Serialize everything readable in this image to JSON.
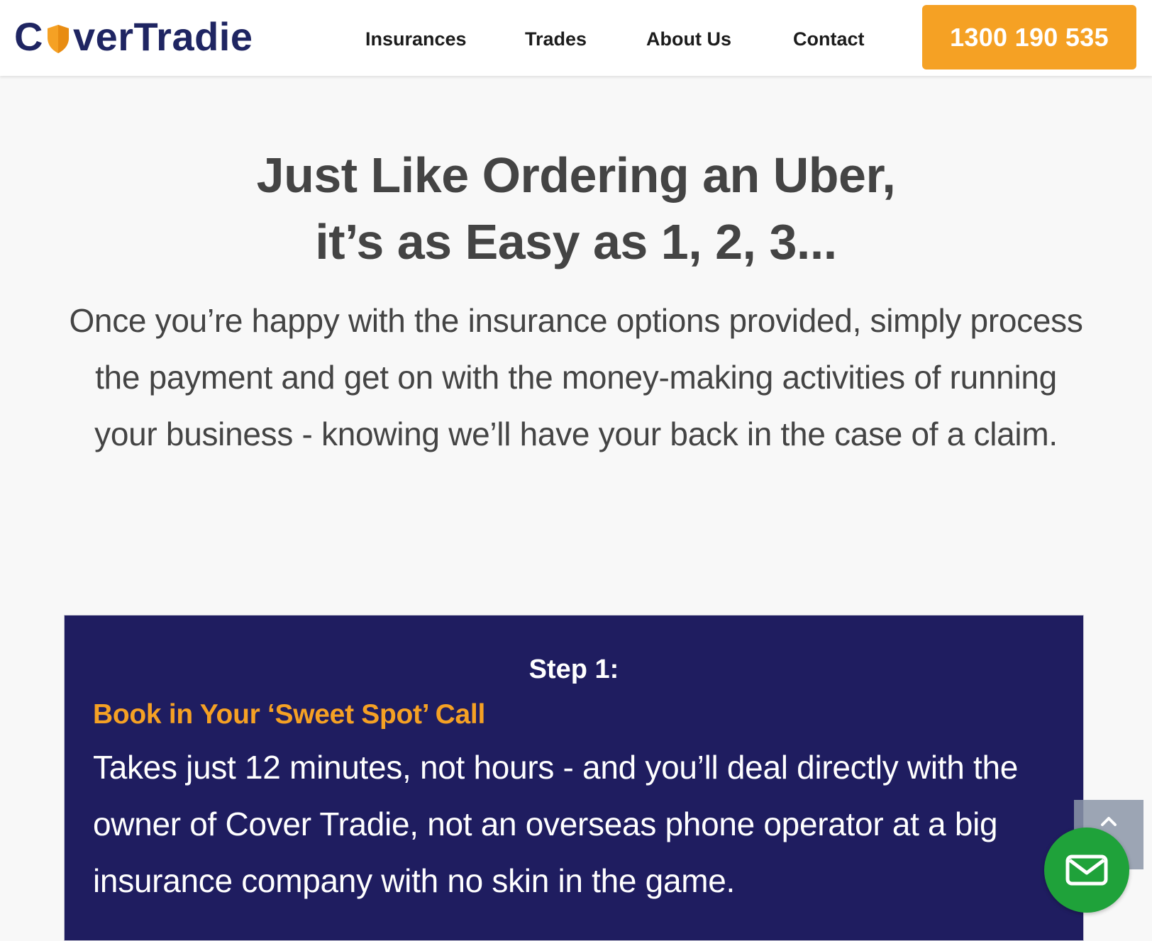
{
  "header": {
    "logo": {
      "part1": "C",
      "part2": "ver",
      "part3": "Tradie"
    },
    "nav": [
      {
        "label": "Insurances"
      },
      {
        "label": "Trades"
      },
      {
        "label": "About Us"
      },
      {
        "label": "Contact"
      }
    ],
    "phone_label": "1300 190 535"
  },
  "hero": {
    "title_line1": "Just Like Ordering an Uber,",
    "title_line2": "it’s as Easy as 1, 2, 3...",
    "text": "Once you’re happy with the insurance options provided, simply process the payment and get on with the money-making activities of running your business - knowing we’ll have your back in the case of a claim."
  },
  "step": {
    "label": "Step 1:",
    "heading": "Book in Your ‘Sweet Spot’ Call",
    "text": "Takes just 12 minutes, not hours - and you’ll deal directly with the owner of Cover Tradie, not an overseas phone operator at a big insurance company with no skin in the game."
  },
  "floating": {
    "scroll_top_icon": "chevron-up-icon",
    "chat_icon": "envelope-icon"
  },
  "colors": {
    "brand_navy": "#1f1d60",
    "accent_orange": "#f5a124",
    "chat_green": "#1fa23a"
  }
}
